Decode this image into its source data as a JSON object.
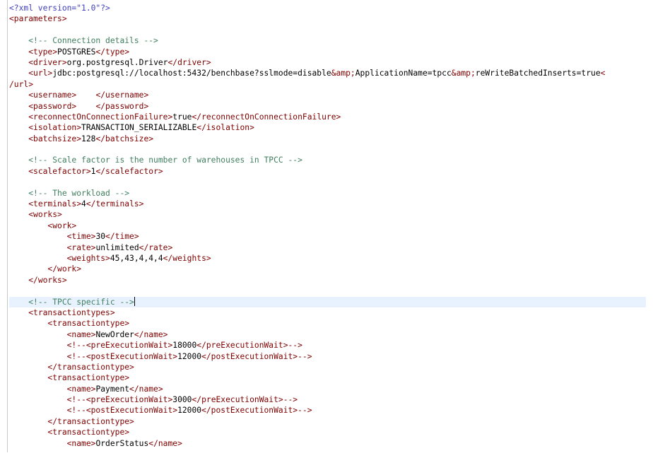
{
  "lines": [
    {
      "indent": 0,
      "parts": [
        {
          "k": "p",
          "t": "<?xml version=\"1.0\"?>"
        }
      ]
    },
    {
      "indent": 0,
      "parts": [
        {
          "k": "t",
          "t": "<parameters>"
        }
      ]
    },
    {
      "indent": 0,
      "parts": []
    },
    {
      "indent": 4,
      "parts": [
        {
          "k": "c",
          "t": "<!-- Connection details -->"
        }
      ]
    },
    {
      "indent": 4,
      "parts": [
        {
          "k": "t",
          "t": "<type>"
        },
        {
          "k": "v",
          "t": "POSTGRES"
        },
        {
          "k": "t",
          "t": "</type>"
        }
      ]
    },
    {
      "indent": 4,
      "parts": [
        {
          "k": "t",
          "t": "<driver>"
        },
        {
          "k": "v",
          "t": "org.postgresql.Driver"
        },
        {
          "k": "t",
          "t": "</driver>"
        }
      ]
    },
    {
      "indent": 4,
      "parts": [
        {
          "k": "t",
          "t": "<url>"
        },
        {
          "k": "v",
          "t": "jdbc:postgresql://localhost:5432/benchbase?sslmode=disable"
        },
        {
          "k": "e",
          "t": "&amp;"
        },
        {
          "k": "v",
          "t": "ApplicationName=tpcc"
        },
        {
          "k": "e",
          "t": "&amp;"
        },
        {
          "k": "v",
          "t": "reWriteBatchedInserts=true"
        },
        {
          "k": "t",
          "t": "<"
        }
      ]
    },
    {
      "indent": 0,
      "parts": [
        {
          "k": "t",
          "t": "/url>"
        }
      ]
    },
    {
      "indent": 4,
      "parts": [
        {
          "k": "t",
          "t": "<username>"
        },
        {
          "k": "v",
          "t": "    "
        },
        {
          "k": "t",
          "t": "</username>"
        }
      ]
    },
    {
      "indent": 4,
      "parts": [
        {
          "k": "t",
          "t": "<password>"
        },
        {
          "k": "v",
          "t": "    "
        },
        {
          "k": "t",
          "t": "</password>"
        }
      ]
    },
    {
      "indent": 4,
      "parts": [
        {
          "k": "t",
          "t": "<reconnectOnConnectionFailure>"
        },
        {
          "k": "v",
          "t": "true"
        },
        {
          "k": "t",
          "t": "</reconnectOnConnectionFailure>"
        }
      ]
    },
    {
      "indent": 4,
      "parts": [
        {
          "k": "t",
          "t": "<isolation>"
        },
        {
          "k": "v",
          "t": "TRANSACTION_SERIALIZABLE"
        },
        {
          "k": "t",
          "t": "</isolation>"
        }
      ]
    },
    {
      "indent": 4,
      "parts": [
        {
          "k": "t",
          "t": "<batchsize>"
        },
        {
          "k": "v",
          "t": "128"
        },
        {
          "k": "t",
          "t": "</batchsize>"
        }
      ]
    },
    {
      "indent": 0,
      "parts": []
    },
    {
      "indent": 4,
      "parts": [
        {
          "k": "c",
          "t": "<!-- Scale factor is the number of warehouses in TPCC -->"
        }
      ]
    },
    {
      "indent": 4,
      "parts": [
        {
          "k": "t",
          "t": "<scalefactor>"
        },
        {
          "k": "v",
          "t": "1"
        },
        {
          "k": "t",
          "t": "</scalefactor>"
        }
      ]
    },
    {
      "indent": 0,
      "parts": []
    },
    {
      "indent": 4,
      "parts": [
        {
          "k": "c",
          "t": "<!-- The workload -->"
        }
      ]
    },
    {
      "indent": 4,
      "parts": [
        {
          "k": "t",
          "t": "<terminals>"
        },
        {
          "k": "v",
          "t": "4"
        },
        {
          "k": "t",
          "t": "</terminals>"
        }
      ]
    },
    {
      "indent": 4,
      "parts": [
        {
          "k": "t",
          "t": "<works>"
        }
      ]
    },
    {
      "indent": 8,
      "parts": [
        {
          "k": "t",
          "t": "<work>"
        }
      ]
    },
    {
      "indent": 12,
      "parts": [
        {
          "k": "t",
          "t": "<time>"
        },
        {
          "k": "v",
          "t": "30"
        },
        {
          "k": "t",
          "t": "</time>"
        }
      ]
    },
    {
      "indent": 12,
      "parts": [
        {
          "k": "t",
          "t": "<rate>"
        },
        {
          "k": "v",
          "t": "unlimited"
        },
        {
          "k": "t",
          "t": "</rate>"
        }
      ]
    },
    {
      "indent": 12,
      "parts": [
        {
          "k": "t",
          "t": "<weights>"
        },
        {
          "k": "v",
          "t": "45,43,4,4,4"
        },
        {
          "k": "t",
          "t": "</weights>"
        }
      ]
    },
    {
      "indent": 8,
      "parts": [
        {
          "k": "t",
          "t": "</work>"
        }
      ]
    },
    {
      "indent": 4,
      "parts": [
        {
          "k": "t",
          "t": "</works>"
        }
      ]
    },
    {
      "indent": 0,
      "parts": []
    },
    {
      "indent": 4,
      "current": true,
      "caret": true,
      "parts": [
        {
          "k": "c",
          "t": "<!-- TPCC specific -->"
        }
      ]
    },
    {
      "indent": 4,
      "parts": [
        {
          "k": "t",
          "t": "<transactiontypes>"
        }
      ]
    },
    {
      "indent": 8,
      "parts": [
        {
          "k": "t",
          "t": "<transactiontype>"
        }
      ]
    },
    {
      "indent": 12,
      "parts": [
        {
          "k": "t",
          "t": "<name>"
        },
        {
          "k": "v",
          "t": "NewOrder"
        },
        {
          "k": "t",
          "t": "</name>"
        }
      ]
    },
    {
      "indent": 12,
      "parts": [
        {
          "k": "t",
          "t": "<!--<preExecutionWait>"
        },
        {
          "k": "v",
          "t": "18000"
        },
        {
          "k": "t",
          "t": "</preExecutionWait>-->"
        }
      ]
    },
    {
      "indent": 12,
      "parts": [
        {
          "k": "t",
          "t": "<!--<postExecutionWait>"
        },
        {
          "k": "v",
          "t": "12000"
        },
        {
          "k": "t",
          "t": "</postExecutionWait>-->"
        }
      ]
    },
    {
      "indent": 8,
      "parts": [
        {
          "k": "t",
          "t": "</transactiontype>"
        }
      ]
    },
    {
      "indent": 8,
      "parts": [
        {
          "k": "t",
          "t": "<transactiontype>"
        }
      ]
    },
    {
      "indent": 12,
      "parts": [
        {
          "k": "t",
          "t": "<name>"
        },
        {
          "k": "v",
          "t": "Payment"
        },
        {
          "k": "t",
          "t": "</name>"
        }
      ]
    },
    {
      "indent": 12,
      "parts": [
        {
          "k": "t",
          "t": "<!--<preExecutionWait>"
        },
        {
          "k": "v",
          "t": "3000"
        },
        {
          "k": "t",
          "t": "</preExecutionWait>-->"
        }
      ]
    },
    {
      "indent": 12,
      "parts": [
        {
          "k": "t",
          "t": "<!--<postExecutionWait>"
        },
        {
          "k": "v",
          "t": "12000"
        },
        {
          "k": "t",
          "t": "</postExecutionWait>-->"
        }
      ]
    },
    {
      "indent": 8,
      "parts": [
        {
          "k": "t",
          "t": "</transactiontype>"
        }
      ]
    },
    {
      "indent": 8,
      "parts": [
        {
          "k": "t",
          "t": "<transactiontype>"
        }
      ]
    },
    {
      "indent": 12,
      "parts": [
        {
          "k": "t",
          "t": "<name>"
        },
        {
          "k": "v",
          "t": "OrderStatus"
        },
        {
          "k": "t",
          "t": "</name>"
        }
      ]
    }
  ]
}
